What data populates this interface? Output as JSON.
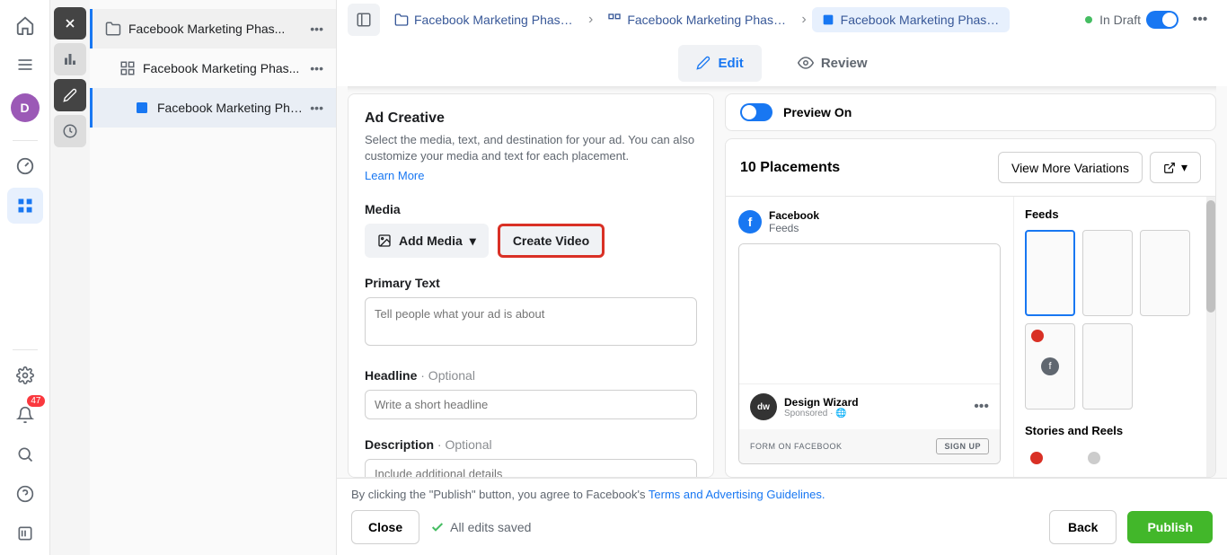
{
  "avatar_initial": "D",
  "notification_count": "47",
  "tree": {
    "items": [
      {
        "label": "Facebook Marketing Phas..."
      },
      {
        "label": "Facebook Marketing Phas..."
      },
      {
        "label": "Facebook Marketing Pha..."
      }
    ]
  },
  "breadcrumbs": [
    {
      "label": "Facebook Marketing Phase ..."
    },
    {
      "label": "Facebook Marketing Phase ..."
    },
    {
      "label": "Facebook Marketing Phase ..."
    }
  ],
  "status_text": "In Draft",
  "tabs": {
    "edit": "Edit",
    "review": "Review"
  },
  "ad_creative": {
    "title": "Ad Creative",
    "desc": "Select the media, text, and destination for your ad. You can also customize your media and text for each placement.",
    "learn_more": "Learn More"
  },
  "media": {
    "label": "Media",
    "add": "Add Media",
    "create_video": "Create Video"
  },
  "primary_text": {
    "label": "Primary Text",
    "placeholder": "Tell people what your ad is about"
  },
  "headline": {
    "label": "Headline",
    "optional": " · Optional",
    "placeholder": "Write a short headline"
  },
  "description": {
    "label": "Description",
    "optional": " · Optional",
    "placeholder": "Include additional details"
  },
  "preview": {
    "label": "Preview On"
  },
  "placements": {
    "title": "10 Placements",
    "view_more": "View More Variations",
    "platform": "Facebook",
    "surface": "Feeds",
    "advertiser": "Design Wizard",
    "sponsored": "Sponsored",
    "form_text": "FORM ON FACEBOOK",
    "signup": "SIGN UP",
    "sections": {
      "feeds": "Feeds",
      "stories": "Stories and Reels"
    }
  },
  "footer": {
    "disclaimer_pre": "By clicking the \"Publish\" button, you agree to Facebook's ",
    "disclaimer_link": "Terms and Advertising Guidelines.",
    "close": "Close",
    "saved": "All edits saved",
    "back": "Back",
    "publish": "Publish"
  }
}
